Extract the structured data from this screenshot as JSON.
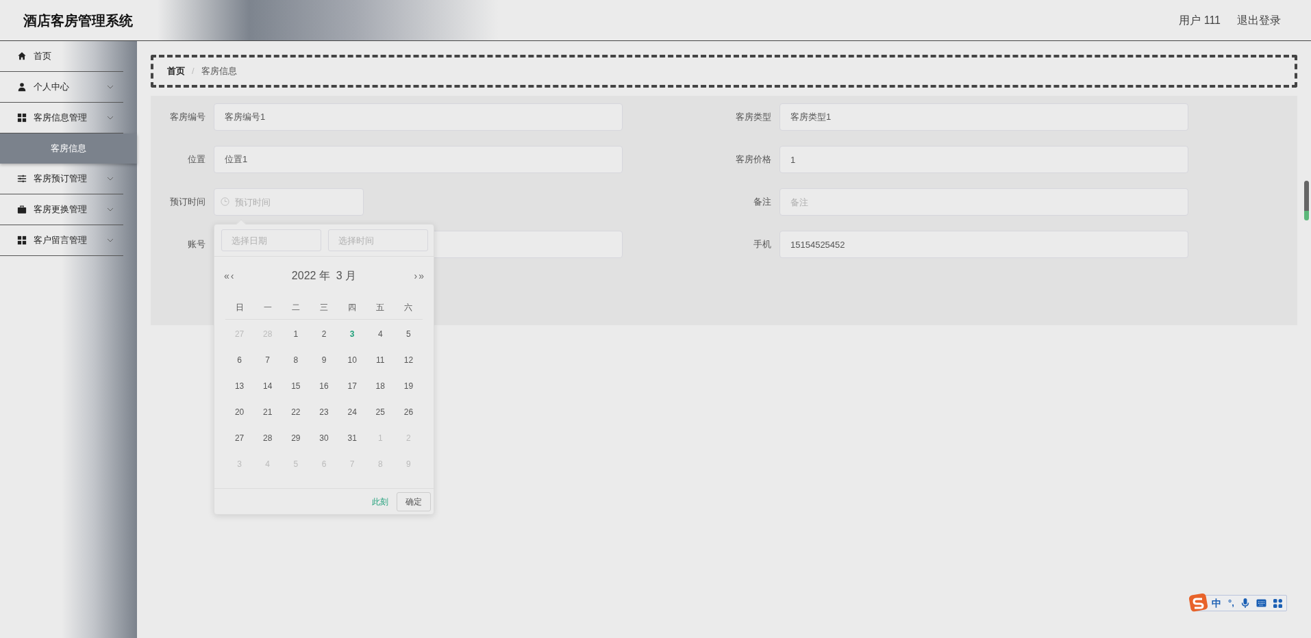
{
  "header": {
    "title": "酒店客房管理系统",
    "user": "用户 111",
    "logout": "退出登录"
  },
  "sidebar": {
    "items": [
      {
        "label": "首页",
        "kind": "link"
      },
      {
        "label": "个人中心",
        "kind": "menu"
      },
      {
        "label": "客房信息管理",
        "kind": "menu",
        "children": [
          {
            "label": "客房信息",
            "selected": true
          }
        ]
      },
      {
        "label": "客房预订管理",
        "kind": "menu"
      },
      {
        "label": "客房更换管理",
        "kind": "menu"
      },
      {
        "label": "客户留言管理",
        "kind": "menu"
      }
    ]
  },
  "breadcrumb": {
    "separator": "/",
    "items": [
      "首页",
      "客房信息"
    ]
  },
  "form": {
    "fields": [
      {
        "label": "客房编号",
        "value": "客房编号1",
        "kind": "text"
      },
      {
        "label": "客房类型",
        "value": "客房类型1",
        "kind": "text"
      },
      {
        "label": "位置",
        "value": "位置1",
        "kind": "text"
      },
      {
        "label": "客房价格",
        "value": "1",
        "kind": "text"
      },
      {
        "label": "预订时间",
        "placeholder": "预订时间",
        "kind": "datetime"
      },
      {
        "label": "备注",
        "placeholder": "备注",
        "kind": "text"
      },
      {
        "label": "账号",
        "kind": "text"
      },
      {
        "label": "手机",
        "value": "15154525452",
        "kind": "text"
      }
    ]
  },
  "datepicker": {
    "date_placeholder": "选择日期",
    "time_placeholder": "选择时间",
    "prev_year": "«",
    "prev_month": "‹",
    "title": "2022 年  3 月",
    "next_month": "›",
    "next_year": "»",
    "weekdays": [
      "日",
      "一",
      "二",
      "三",
      "四",
      "五",
      "六"
    ],
    "days": [
      {
        "label": "27",
        "kind": "other",
        "today": false
      },
      {
        "label": "28",
        "kind": "other",
        "today": false
      },
      {
        "label": "1",
        "kind": "current",
        "today": false
      },
      {
        "label": "2",
        "kind": "current",
        "today": false
      },
      {
        "label": "3",
        "kind": "current",
        "today": true
      },
      {
        "label": "4",
        "kind": "current",
        "today": false
      },
      {
        "label": "5",
        "kind": "current",
        "today": false
      },
      {
        "label": "6",
        "kind": "current",
        "today": false
      },
      {
        "label": "7",
        "kind": "current",
        "today": false
      },
      {
        "label": "8",
        "kind": "current",
        "today": false
      },
      {
        "label": "9",
        "kind": "current",
        "today": false
      },
      {
        "label": "10",
        "kind": "current",
        "today": false
      },
      {
        "label": "11",
        "kind": "current",
        "today": false
      },
      {
        "label": "12",
        "kind": "current",
        "today": false
      },
      {
        "label": "13",
        "kind": "current",
        "today": false
      },
      {
        "label": "14",
        "kind": "current",
        "today": false
      },
      {
        "label": "15",
        "kind": "current",
        "today": false
      },
      {
        "label": "16",
        "kind": "current",
        "today": false
      },
      {
        "label": "17",
        "kind": "current",
        "today": false
      },
      {
        "label": "18",
        "kind": "current",
        "today": false
      },
      {
        "label": "19",
        "kind": "current",
        "today": false
      },
      {
        "label": "20",
        "kind": "current",
        "today": false
      },
      {
        "label": "21",
        "kind": "current",
        "today": false
      },
      {
        "label": "22",
        "kind": "current",
        "today": false
      },
      {
        "label": "23",
        "kind": "current",
        "today": false
      },
      {
        "label": "24",
        "kind": "current",
        "today": false
      },
      {
        "label": "25",
        "kind": "current",
        "today": false
      },
      {
        "label": "26",
        "kind": "current",
        "today": false
      },
      {
        "label": "27",
        "kind": "current",
        "today": false
      },
      {
        "label": "28",
        "kind": "current",
        "today": false
      },
      {
        "label": "29",
        "kind": "current",
        "today": false
      },
      {
        "label": "30",
        "kind": "current",
        "today": false
      },
      {
        "label": "31",
        "kind": "current",
        "today": false
      },
      {
        "label": "1",
        "kind": "other",
        "today": false
      },
      {
        "label": "2",
        "kind": "other",
        "today": false
      },
      {
        "label": "3",
        "kind": "other",
        "today": false
      },
      {
        "label": "4",
        "kind": "other",
        "today": false
      },
      {
        "label": "5",
        "kind": "other",
        "today": false
      },
      {
        "label": "6",
        "kind": "other",
        "today": false
      },
      {
        "label": "7",
        "kind": "other",
        "today": false
      },
      {
        "label": "8",
        "kind": "other",
        "today": false
      },
      {
        "label": "9",
        "kind": "other",
        "today": false
      }
    ],
    "now": "此刻",
    "confirm": "确定"
  },
  "ime": {
    "mode": "中",
    "punctuation": "°,"
  }
}
